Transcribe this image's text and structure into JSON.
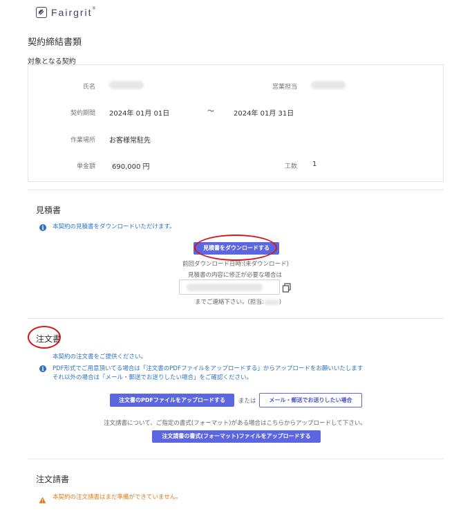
{
  "brand": {
    "name": "Fairgrit",
    "reg": "®"
  },
  "page_title": "契約締結書類",
  "contract": {
    "section_label": "対象となる契約",
    "name_label": "氏名",
    "sales_label": "営業担当",
    "period_label": "契約期間",
    "period_start": "2024年 01月 01日",
    "period_sep": "〜",
    "period_end": "2024年 01月 31日",
    "location_label": "作業場所",
    "location_value": "お客様常駐先",
    "price_label": "単金額",
    "price_value": "690,000 円",
    "man_hours_label": "工数",
    "man_hours_value": "1"
  },
  "estimate": {
    "title": "見積書",
    "info": "本契約の見積書をダウンロードいただけます。",
    "download_button": "見積書をダウンロードする",
    "last_download": "前回ダウンロード日時:(未ダウンロード)",
    "fix_note": "見積書の内容に修正が必要な場合は",
    "contact_note": "までご連絡下さい。(担当:",
    "contact_close": ")"
  },
  "order": {
    "title": "注文書",
    "info_line1": "本契約の注文書をご提供ください。",
    "info_line2": "PDF形式でご用意頂いてる場合は「注文書のPDFファイルをアップロードする」からアップロードをお願いいたします",
    "info_line3": "それ以外の場合は「メール・郵送でお送りしたい場合」をご確認ください。",
    "upload_pdf_button": "注文書のPDFファイルをアップロードする",
    "or_text": "または",
    "mail_button": "メール・郵送でお送りしたい場合",
    "format_note": "注文請書について、ご指定の書式(フォーマット)がある場合はこちらからアップロードして下さい。",
    "format_upload_button": "注文請書の書式(フォーマット)ファイルをアップロードする"
  },
  "acceptance": {
    "title": "注文請書",
    "warning": "本契約の注文請書はまだ準備ができていません。"
  },
  "colors": {
    "accent": "#5b66e0",
    "info": "#2b73c2",
    "warning": "#e07a1c",
    "highlight_ring": "#d31818"
  }
}
